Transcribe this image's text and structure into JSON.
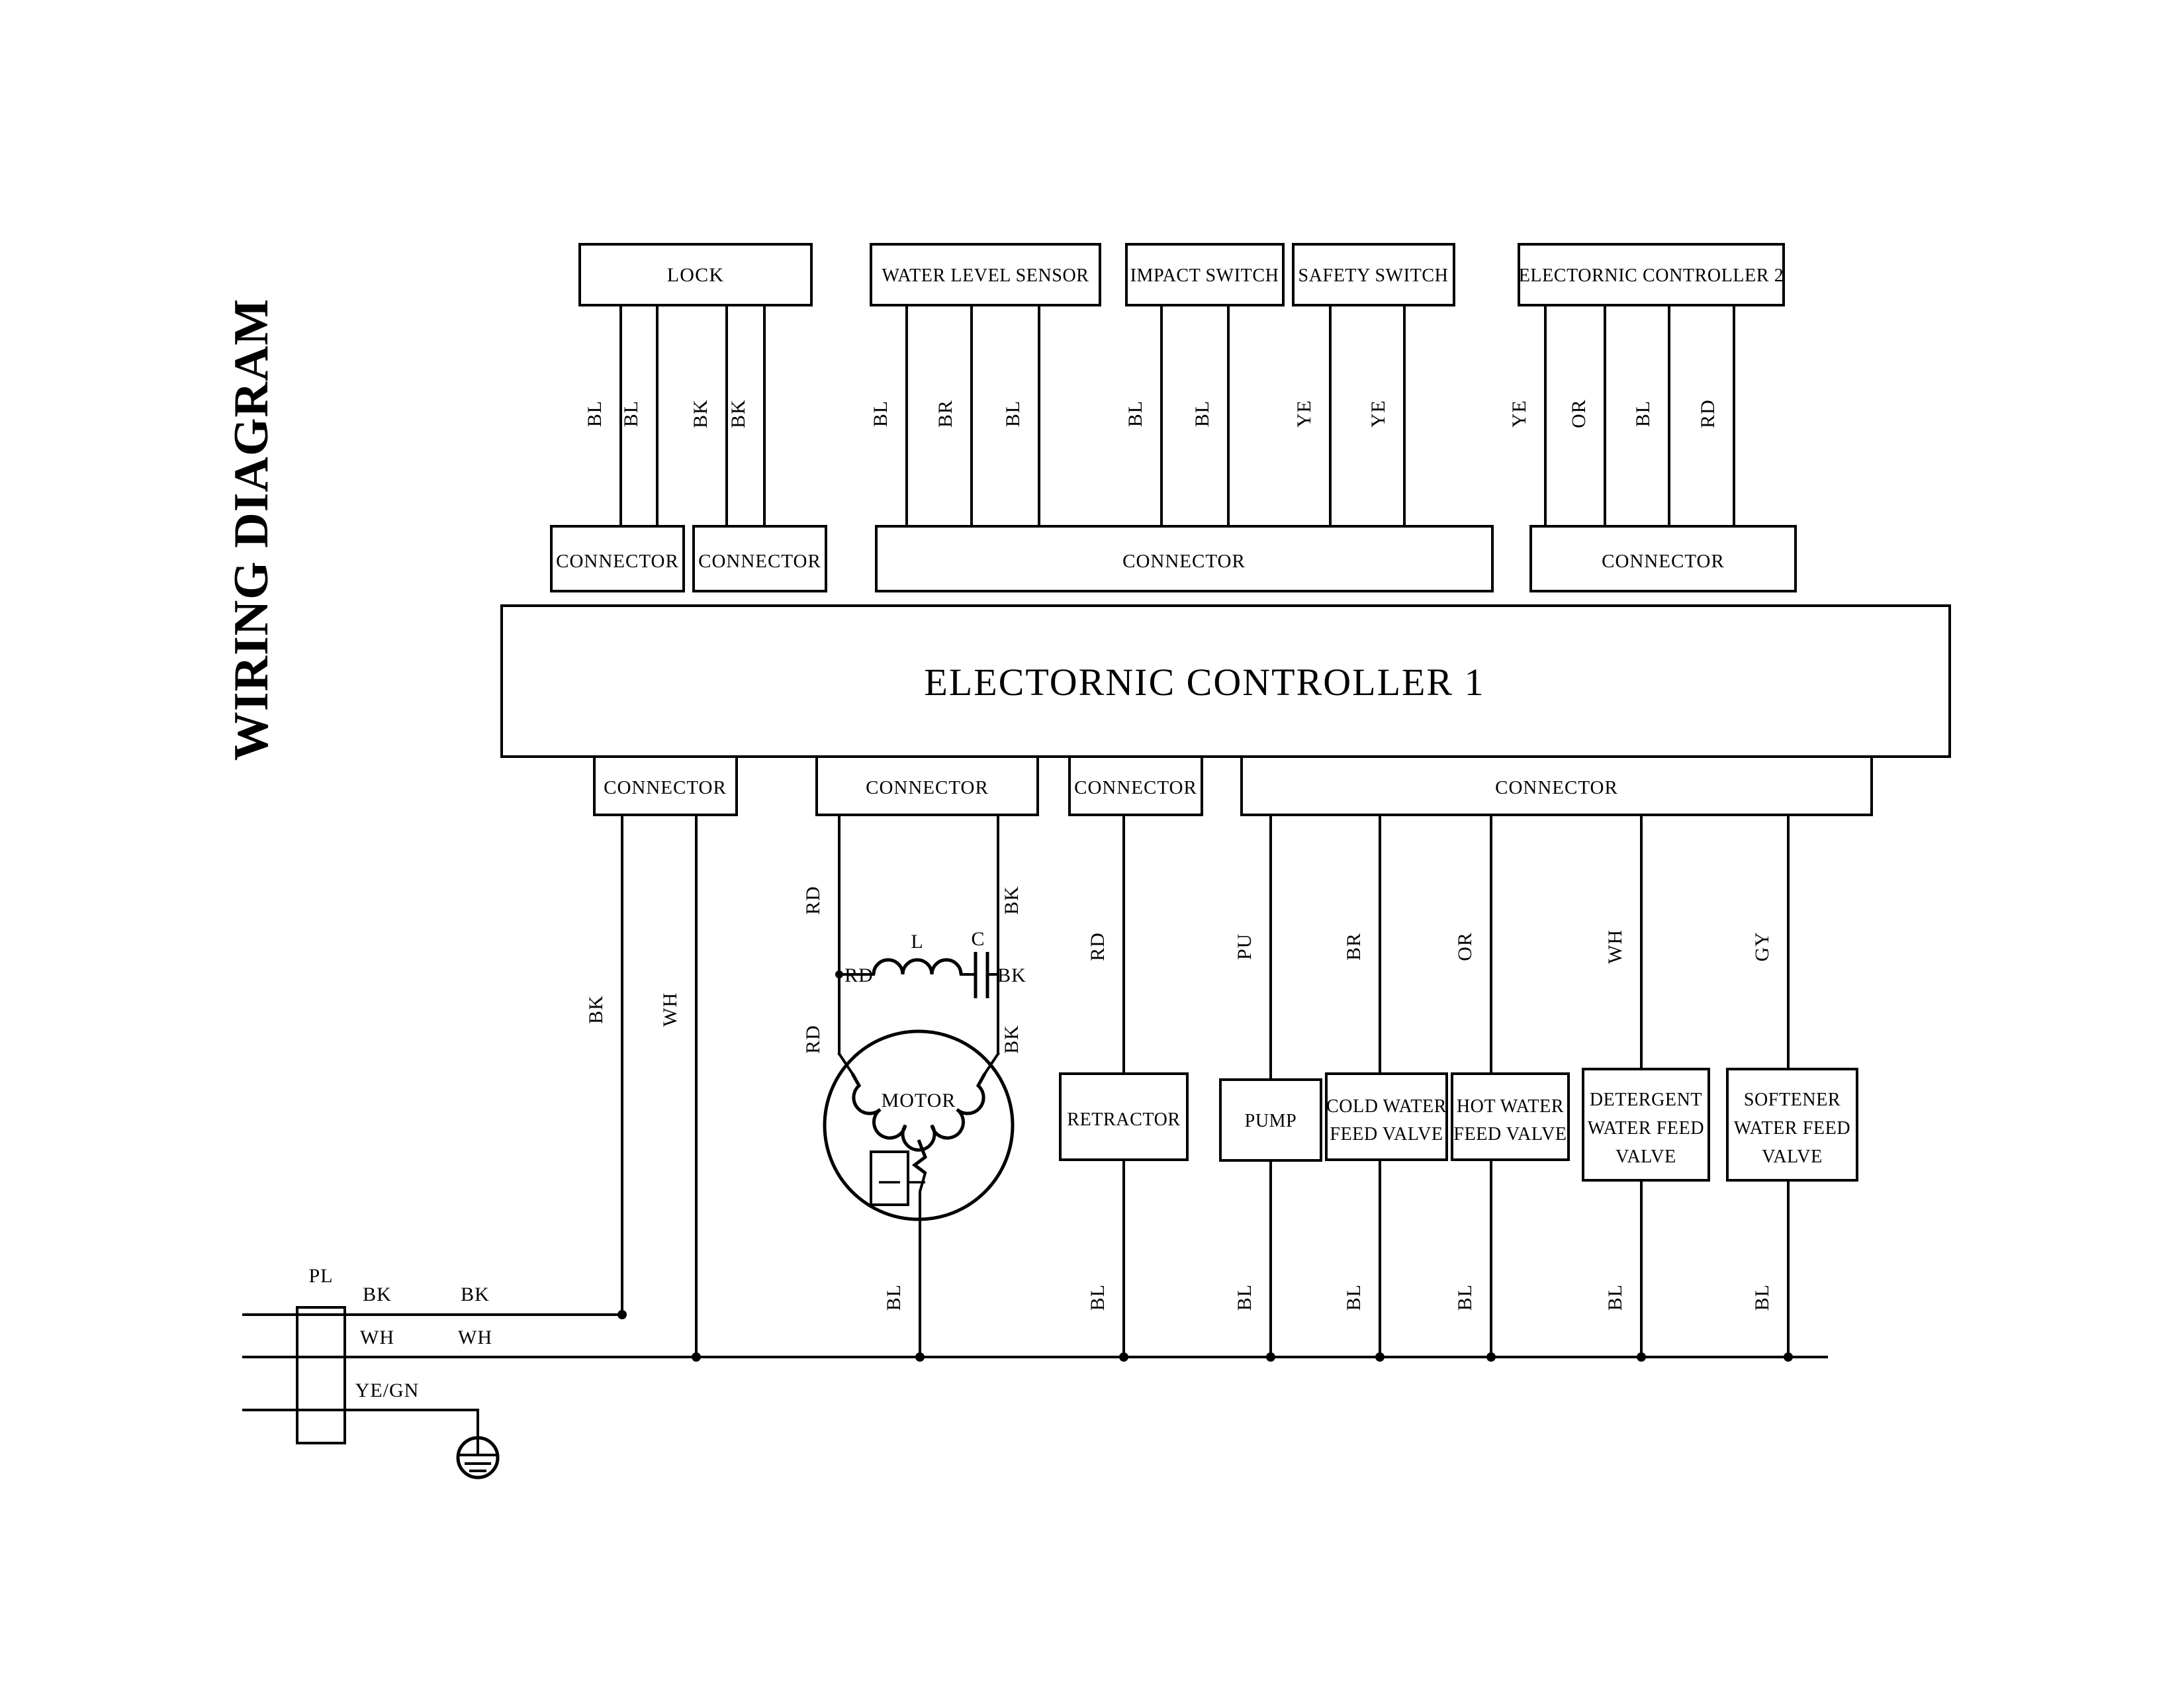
{
  "document": {
    "title": "WIRING DIAGRAM"
  },
  "top_devices": [
    {
      "label": "LOCK"
    },
    {
      "label": "WATER LEVEL SENSOR"
    },
    {
      "label": "IMPACT SWITCH"
    },
    {
      "label": "SAFETY SWITCH"
    },
    {
      "label": "ELECTORNIC CONTROLLER 2"
    }
  ],
  "top_wires": [
    {
      "color": "BL"
    },
    {
      "color": "BL"
    },
    {
      "color": "BK"
    },
    {
      "color": "BK"
    },
    {
      "color": "BL"
    },
    {
      "color": "BR"
    },
    {
      "color": "BL"
    },
    {
      "color": "BL"
    },
    {
      "color": "BL"
    },
    {
      "color": "YE"
    },
    {
      "color": "YE"
    },
    {
      "color": "YE"
    },
    {
      "color": "OR"
    },
    {
      "color": "BL"
    },
    {
      "color": "RD"
    }
  ],
  "upper_connectors": [
    {
      "label": "CONNECTOR"
    },
    {
      "label": "CONNECTOR"
    },
    {
      "label": "CONNECTOR"
    },
    {
      "label": "CONNECTOR"
    }
  ],
  "controller": {
    "label": "ELECTORNIC CONTROLLER 1"
  },
  "lower_connectors": [
    {
      "label": "CONNECTOR"
    },
    {
      "label": "CONNECTOR"
    },
    {
      "label": "CONNECTOR"
    },
    {
      "label": "CONNECTOR"
    }
  ],
  "lower_wires": [
    {
      "color": "BK"
    },
    {
      "color": "WH"
    },
    {
      "color": "RD"
    },
    {
      "color": "BK"
    },
    {
      "color": "RD"
    },
    {
      "color": "PU"
    },
    {
      "color": "BR"
    },
    {
      "color": "OR"
    },
    {
      "color": "WH"
    },
    {
      "color": "GY"
    }
  ],
  "motor_circuit": {
    "motor_label": "MOTOR",
    "inductor_label": "L",
    "capacitor_label": "C",
    "lead_left_top": "RD",
    "lead_right_top": "BK",
    "lead_left_mid": "RD",
    "lead_right_mid": "BK",
    "lead_left_bottom": "RD",
    "lead_right_bottom": "BK",
    "return_color": "BL"
  },
  "bottom_devices": [
    {
      "label_lines": [
        "RETRACTOR"
      ]
    },
    {
      "label_lines": [
        "PUMP"
      ]
    },
    {
      "label_lines": [
        "COLD WATER",
        "FEED VALVE"
      ]
    },
    {
      "label_lines": [
        "HOT WATER",
        "FEED VALVE"
      ]
    },
    {
      "label_lines": [
        "DETERGENT",
        "WATER FEED",
        "VALVE"
      ]
    },
    {
      "label_lines": [
        "SOFTENER",
        "WATER FEED",
        "VALVE"
      ]
    }
  ],
  "return_wires": [
    {
      "color": "BL"
    },
    {
      "color": "BL"
    },
    {
      "color": "BL"
    },
    {
      "color": "BL"
    },
    {
      "color": "BL"
    },
    {
      "color": "BL"
    },
    {
      "color": "BL"
    },
    {
      "color": "BL"
    }
  ],
  "power_inlet": {
    "plug_label": "PL",
    "line_live_left": "BK",
    "line_live_right": "BK",
    "line_neutral_left": "WH",
    "line_neutral_right": "WH",
    "line_earth": "YE/GN",
    "earth_symbol": "earth-ground-icon"
  },
  "colors": {
    "ink": "#000000",
    "paper": "#ffffff"
  }
}
